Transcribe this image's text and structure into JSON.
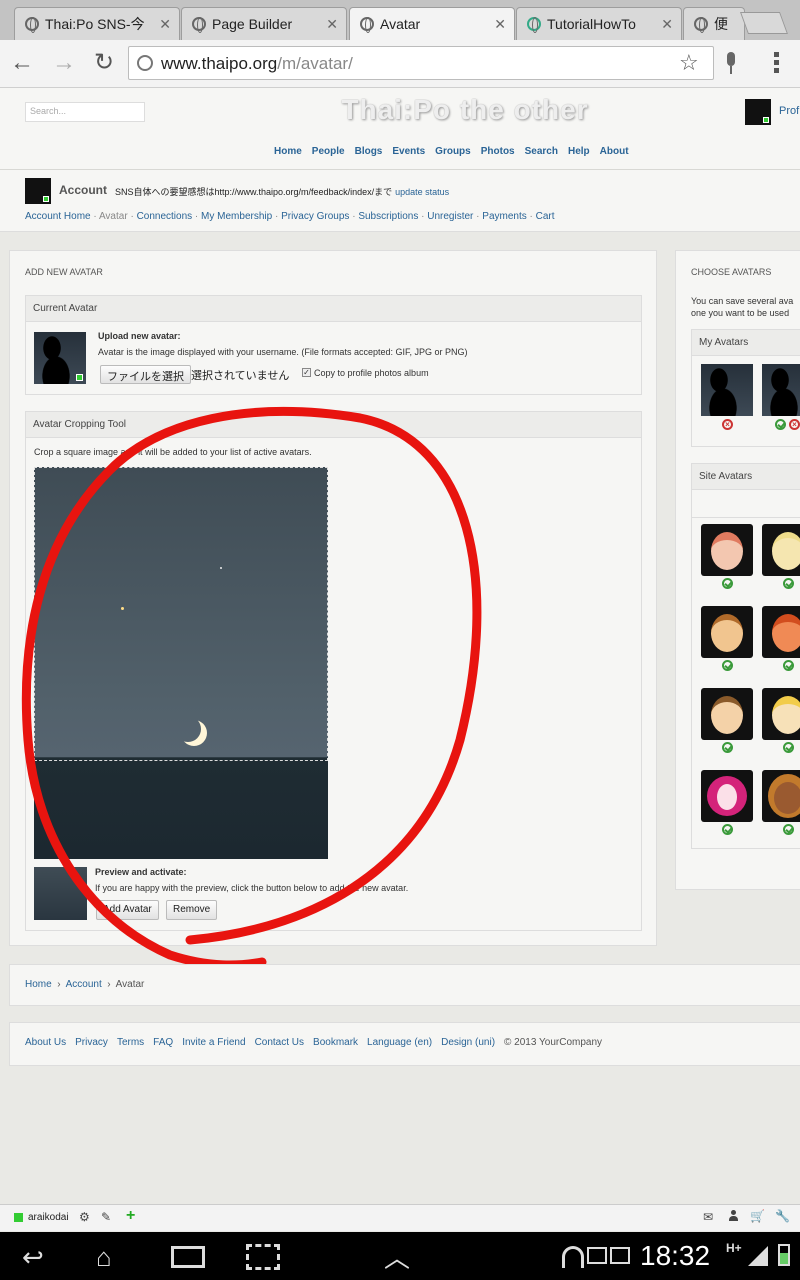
{
  "browser": {
    "tabs": [
      {
        "label": "Thai:Po SNS-今"
      },
      {
        "label": "Page Builder"
      },
      {
        "label": "Avatar"
      },
      {
        "label": "TutorialHowTo"
      },
      {
        "label": "便"
      }
    ],
    "url_domain": "www.thaipo.org",
    "url_path": "/m/avatar/"
  },
  "site": {
    "search_placeholder": "Search...",
    "title": "Thai:Po the other",
    "profile_label": "Prof",
    "nav": [
      "Home",
      "People",
      "Blogs",
      "Events",
      "Groups",
      "Photos",
      "Search",
      "Help",
      "About"
    ]
  },
  "account": {
    "title": "Account",
    "status_text": "SNS自体への要望感想はhttp://www.thaipo.org/m/feedback/index/まで",
    "update_status": "update status",
    "subnav": [
      "Account Home",
      "Avatar",
      "Connections",
      "My Membership",
      "Privacy Groups",
      "Subscriptions",
      "Unregister",
      "Payments",
      "Cart"
    ]
  },
  "add_avatar": {
    "heading": "ADD NEW AVATAR",
    "current_box_title": "Current Avatar",
    "upload_title": "Upload new avatar:",
    "upload_desc": "Avatar is the image displayed with your username. (File formats accepted: GIF, JPG or PNG)",
    "choose_file_button": "ファイルを選択",
    "no_file_selected": "選択されていません",
    "copy_to_album_label": "Copy to profile photos album",
    "copy_to_album_checked": true,
    "crop_box_title": "Avatar Cropping Tool",
    "crop_instructions": "Crop a square image and it will be added to your list of active avatars.",
    "preview_title": "Preview and activate:",
    "preview_desc": "If you are happy with the preview, click the button below to add the new avatar.",
    "add_button": "Add Avatar",
    "remove_button": "Remove"
  },
  "choose_avatars": {
    "heading": "CHOOSE AVATARS",
    "desc_line1": "You can save several ava",
    "desc_line2": "one you want to be used",
    "my_avatars_title": "My Avatars",
    "site_avatars_title": "Site Avatars"
  },
  "breadcrumb": [
    "Home",
    "Account",
    "Avatar"
  ],
  "footer": {
    "links": [
      "About Us",
      "Privacy",
      "Terms",
      "FAQ",
      "Invite a Friend",
      "Contact Us",
      "Bookmark",
      "Language (en)",
      "Design (uni)"
    ],
    "copyright": "© 2013 YourCompany"
  },
  "bottom_bar": {
    "username": "araikodai"
  },
  "system": {
    "clock": "18:32",
    "network": "H+"
  }
}
